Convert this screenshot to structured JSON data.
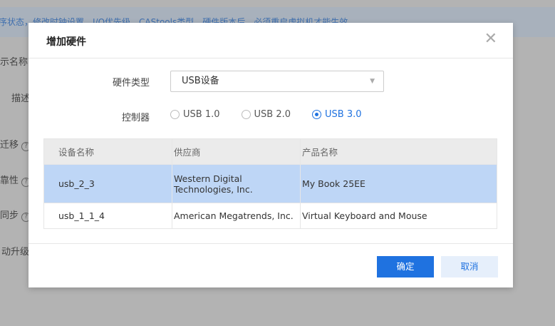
{
  "background": {
    "banner": "序状态，修改时钟设置、I/O优先级、CAStools类型、硬件版本后，必须重启虚拟机才能生效",
    "labels": [
      "示名称",
      "描述",
      "迁移",
      "靠性",
      "同步",
      "动升级"
    ]
  },
  "dialog": {
    "title": "增加硬件",
    "close_icon": "close-icon",
    "hardware_type_label": "硬件类型",
    "hardware_type_value": "USB设备",
    "controller_label": "控制器",
    "controller_options": [
      "USB 1.0",
      "USB 2.0",
      "USB 3.0"
    ],
    "controller_selected": "USB 3.0",
    "table": {
      "headers": [
        "设备名称",
        "供应商",
        "产品名称"
      ],
      "rows": [
        [
          "usb_2_3",
          "Western Digital Technologies, Inc.",
          "My Book 25EE"
        ],
        [
          "usb_1_1_4",
          "American Megatrends, Inc.",
          "Virtual Keyboard and Mouse"
        ]
      ]
    },
    "ok_label": "确定",
    "cancel_label": "取消"
  },
  "colors": {
    "accent": "#1f72e0",
    "selected_row": "#bed6f6"
  }
}
